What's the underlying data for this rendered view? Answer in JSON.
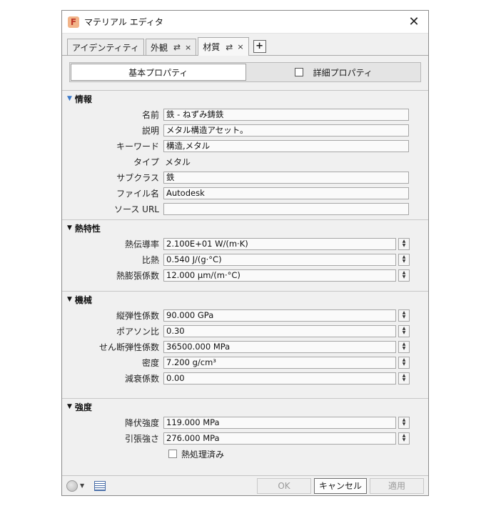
{
  "window": {
    "title": "マテリアル エディタ",
    "app_icon_letter": "F"
  },
  "tabs": [
    {
      "label": "アイデンティティ"
    },
    {
      "label": "外観",
      "swap_icon": "⇄",
      "close_icon": "×"
    },
    {
      "label": "材質",
      "swap_icon": "⇄",
      "close_icon": "×"
    }
  ],
  "tab_add_label": "+",
  "segments": {
    "basic": "基本プロパティ",
    "advanced": "詳細プロパティ"
  },
  "sections": {
    "info": {
      "title": "情報",
      "name_label": "名前",
      "name_value": "鉄 - ねずみ鋳鉄",
      "desc_label": "説明",
      "desc_value": "メタル構造アセット。",
      "keyword_label": "キーワード",
      "keyword_value": "構造,メタル",
      "type_label": "タイプ",
      "type_value": "メタル",
      "subclass_label": "サブクラス",
      "subclass_value": "鉄",
      "filename_label": "ファイル名",
      "filename_value": "Autodesk",
      "source_label": "ソース URL",
      "source_value": ""
    },
    "thermal": {
      "title": "熱特性",
      "conductivity_label": "熱伝導率",
      "conductivity_value": "2.100E+01 W/(m·K)",
      "specific_heat_label": "比熱",
      "specific_heat_value": "0.540 J/(g·°C)",
      "expansion_label": "熱膨張係数",
      "expansion_value": "12.000 µm/(m·°C)"
    },
    "mechanical": {
      "title": "機械",
      "youngs_label": "縦弾性係数",
      "youngs_value": "90.000 GPa",
      "poisson_label": "ポアソン比",
      "poisson_value": "0.30",
      "shear_label": "せん断弾性係数",
      "shear_value": "36500.000 MPa",
      "density_label": "密度",
      "density_value": "7.200 g/cm³",
      "damping_label": "減衰係数",
      "damping_value": "0.00"
    },
    "strength": {
      "title": "強度",
      "yield_label": "降伏強度",
      "yield_value": "119.000 MPa",
      "tensile_label": "引張強さ",
      "tensile_value": "276.000 MPa",
      "heat_treated_label": "熱処理済み"
    }
  },
  "buttons": {
    "ok": "OK",
    "cancel": "キャンセル",
    "apply": "適用"
  },
  "icons": {
    "close": "close-icon",
    "swap": "swap-icon",
    "expand": "triangle-down-icon",
    "globe": "globe-icon",
    "list": "list-view-icon"
  }
}
